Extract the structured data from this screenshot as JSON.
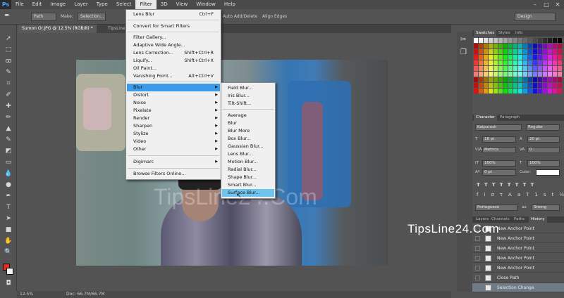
{
  "app": {
    "logo": "Ps",
    "menu": [
      "File",
      "Edit",
      "Image",
      "Layer",
      "Type",
      "Select",
      "Filter",
      "3D",
      "View",
      "Window",
      "Help"
    ],
    "active_menu": "Filter"
  },
  "options": {
    "path_select": "Path",
    "make_label": "Make:",
    "selection_button": "Selection...",
    "auto_add_delete": "Auto Add/Delete",
    "align_edges": "Align Edges",
    "workspace": "Design"
  },
  "tabs": [
    {
      "label": "Sumon Or.JPG @ 12.5% (RGB/8) *"
    },
    {
      "label": "TipsLine"
    }
  ],
  "filter_menu": {
    "items": [
      {
        "label": "Lens Blur",
        "shortcut": "Ctrl+F"
      },
      {
        "label": "Convert for Smart Filters"
      },
      {
        "label": "Filter Gallery..."
      },
      {
        "label": "Adaptive Wide Angle..."
      },
      {
        "label": "Lens Correction...",
        "shortcut": "Shift+Ctrl+R"
      },
      {
        "label": "Liquify...",
        "shortcut": "Shift+Ctrl+X"
      },
      {
        "label": "Oil Paint..."
      },
      {
        "label": "Vanishing Point...",
        "shortcut": "Alt+Ctrl+V"
      },
      {
        "label": "Blur"
      },
      {
        "label": "Distort"
      },
      {
        "label": "Noise"
      },
      {
        "label": "Pixelate"
      },
      {
        "label": "Render"
      },
      {
        "label": "Sharpen"
      },
      {
        "label": "Stylize"
      },
      {
        "label": "Video"
      },
      {
        "label": "Other"
      },
      {
        "label": "Digimarc"
      },
      {
        "label": "Browse Filters Online..."
      }
    ],
    "highlighted": "Blur"
  },
  "blur_menu": {
    "items": [
      "Field Blur...",
      "Iris Blur...",
      "Tilt-Shift...",
      "Average",
      "Blur",
      "Blur More",
      "Box Blur...",
      "Gaussian Blur...",
      "Lens Blur...",
      "Motion Blur...",
      "Radial Blur...",
      "Shape Blur...",
      "Smart Blur...",
      "Surface Blur..."
    ],
    "highlighted": "Surface Blur..."
  },
  "swatches_panel": {
    "tabs": [
      "Swatches",
      "Styles",
      "Info"
    ]
  },
  "character_panel": {
    "tabs": [
      "Character",
      "Paragraph"
    ],
    "font_family": "Kalpurush",
    "font_style": "Regular",
    "size": "18 pt",
    "leading": "20 pt",
    "kerning": "Metrics",
    "tracking": "0",
    "vscale": "100%",
    "hscale": "100%",
    "baseline": "0 pt",
    "color_label": "Color:",
    "language": "Portuguese",
    "antialias": "Strong"
  },
  "history_panel": {
    "tabs": [
      "Layers",
      "Channels",
      "Paths",
      "History"
    ],
    "items": [
      "New Anchor Point",
      "New Anchor Point",
      "New Anchor Point",
      "New Anchor Point",
      "New Anchor Point",
      "Close Path",
      "Selection Change"
    ],
    "selected": "Selection Change"
  },
  "status": {
    "zoom": "12.5%",
    "doc": "Doc: 66.7M/66.7M"
  },
  "watermark": "TipsLine24.Com",
  "canvas_watermark": "TipsLine24.Com",
  "colors": {
    "highlight": "#3c9be8",
    "submenu_highlight": "#6fc3ee",
    "foreground": "#e32b1c",
    "background": "#f5f5f5"
  }
}
